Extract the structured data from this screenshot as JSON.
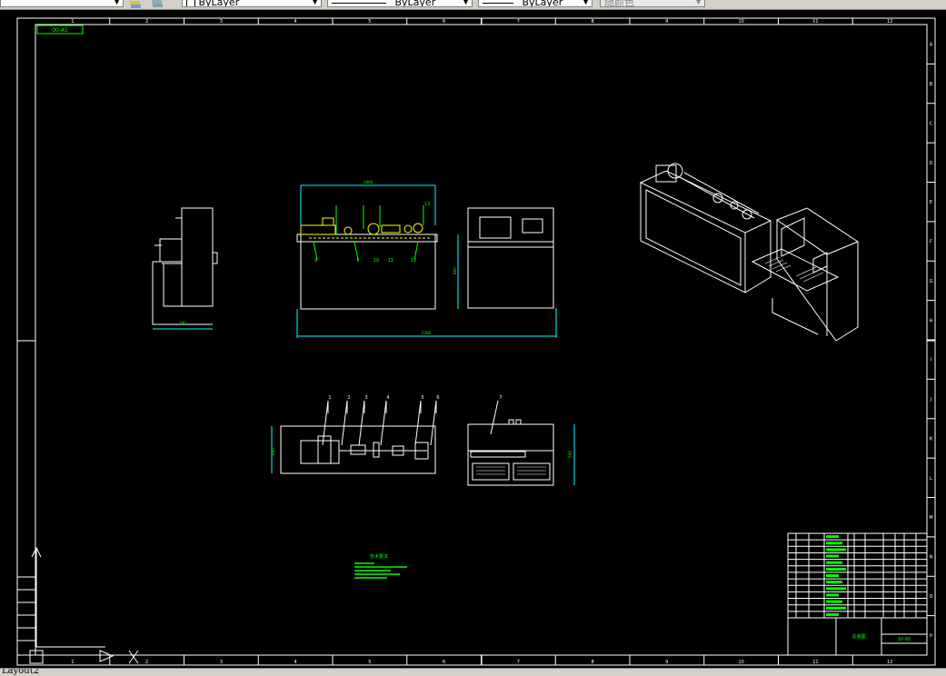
{
  "toolbar": {
    "color_control": "ByLayer",
    "linetype_control": "ByLayer",
    "lineweight_control": "ByLayer",
    "plotstyle_control": "随颜色"
  },
  "drawing": {
    "title_tag": "00-A5",
    "column_numbers": [
      "1",
      "2",
      "3",
      "4",
      "5",
      "6",
      "7",
      "8",
      "9",
      "10",
      "11",
      "12"
    ],
    "row_letters": [
      "A",
      "B",
      "C",
      "D",
      "E",
      "F",
      "G",
      "H",
      "I",
      "J",
      "K",
      "L",
      "M",
      "N",
      "O",
      "P"
    ],
    "front_view": {
      "width_dim": "1800",
      "overall_dim": "2200",
      "height_dim": "800",
      "side_dim": "700",
      "callouts": [
        "8",
        "9",
        "10",
        "11",
        "12",
        "13"
      ]
    },
    "top_view": {
      "callouts": [
        "1",
        "2",
        "3",
        "4",
        "5",
        "6"
      ],
      "depth_dim": "600"
    },
    "control_box": {
      "callouts": [
        "7"
      ],
      "depth_dim": "500"
    },
    "tech_notes_title": "技术要求",
    "title_block": {
      "drawing_number": "SY-00",
      "name": "总装图"
    }
  },
  "status": {
    "layout_tab": "Layout2"
  }
}
